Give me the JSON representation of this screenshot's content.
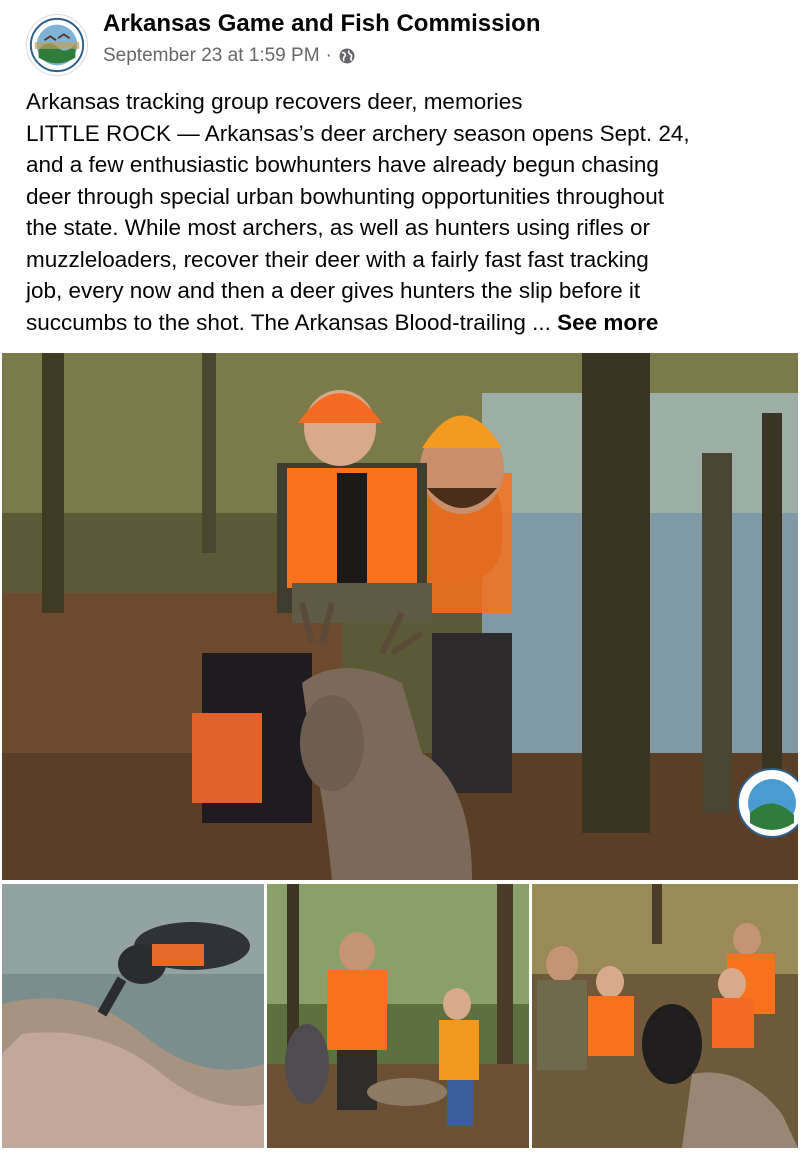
{
  "post": {
    "page_name": "Arkansas Game and Fish Commission",
    "timestamp": "September 23 at 1:59 PM",
    "separator": "·",
    "audience_icon": "globe-icon",
    "text_lines": [
      "Arkansas tracking group recovers deer, memories",
      "LITTLE ROCK — Arkansas’s deer archery season opens Sept. 24,",
      "and a few enthusiastic bowhunters have already begun chasing",
      "deer through special urban bowhunting opportunities throughout",
      "the state. While most archers, as well as hunters using rifles or",
      "muzzleloaders, recover their deer with a fairly fast fast tracking",
      "job, every now and then a deer gives hunters the slip before it",
      "succumbs to the shot. The Arkansas Blood-trailing ... "
    ],
    "see_more": "See more"
  },
  "colors": {
    "blaze_orange": "#f7721c",
    "forest_green": "#4a5a2c",
    "water_blue": "#7f9aa4",
    "leaf_brown": "#6b4a2e",
    "meta_gray": "#65676b"
  }
}
